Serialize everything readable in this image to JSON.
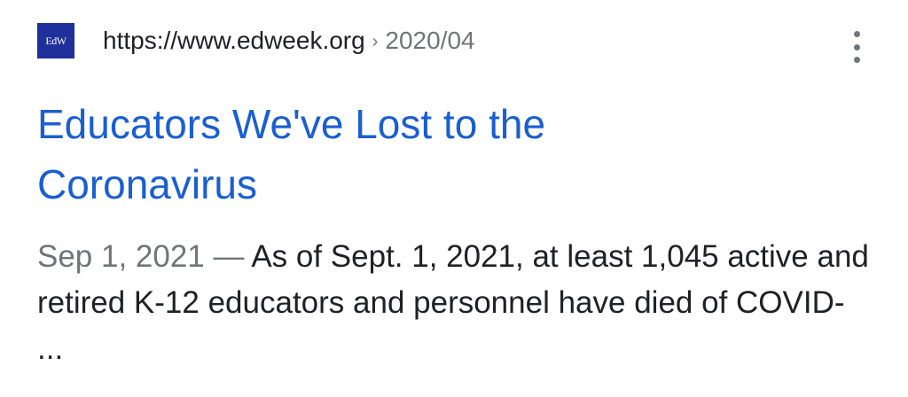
{
  "result": {
    "favicon_text": "EdW",
    "favicon_color": "#1f2f9b",
    "url": "https://www.edweek.org",
    "breadcrumb_separator": "›",
    "path": "2020/04",
    "more_icon": "more-vert-icon",
    "title_line1": "Educators We've Lost to the",
    "title_line2": "Coronavirus",
    "title_color": "#1a5fd0",
    "snippet_date": "Sep 1, 2021",
    "snippet_dash": "—",
    "snippet_text": "As of Sept. 1, 2021, at least 1,045 active and retired K-12 educators and personnel have died of COVID- ..."
  }
}
